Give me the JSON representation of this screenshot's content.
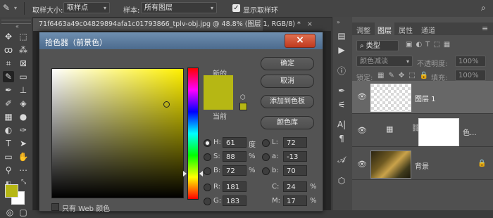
{
  "options_bar": {
    "sample_size_label": "取样大小:",
    "sample_size_value": "取样点",
    "sample_label": "样本:",
    "sample_value": "所有图层",
    "show_ring_label": "显示取样环",
    "show_ring_checked": true
  },
  "document": {
    "tab_title": "71f6463a49c04829894afa1c01793866_tplv-obj.jpg @ 48.8% (图层 1, RGB/8) *",
    "close_glyph": "×"
  },
  "color_picker": {
    "title": "拾色器（前景色）",
    "new_label": "新的",
    "current_label": "当前",
    "new_color": "#b6b714",
    "current_color": "#b6b714",
    "buttons": {
      "ok": "确定",
      "cancel": "取消",
      "add_to_swatches": "添加到色板",
      "color_libraries": "颜色库"
    },
    "hsb": {
      "h": {
        "label": "H:",
        "value": "61",
        "unit": "度",
        "selected": true
      },
      "s": {
        "label": "S:",
        "value": "88",
        "unit": "%"
      },
      "b": {
        "label": "B:",
        "value": "72",
        "unit": "%"
      }
    },
    "lab": {
      "l": {
        "label": "L:",
        "value": "72"
      },
      "a": {
        "label": "a:",
        "value": "-13"
      },
      "b": {
        "label": "b:",
        "value": "70"
      }
    },
    "rgb": {
      "r": {
        "label": "R:",
        "value": "181"
      },
      "g": {
        "label": "G:",
        "value": "183"
      }
    },
    "cmyk": {
      "c": {
        "label": "C:",
        "value": "24",
        "unit": "%"
      },
      "m": {
        "label": "M:",
        "value": "17",
        "unit": "%"
      }
    },
    "web_only_label": "只有 Web 颜色",
    "web_only_checked": false
  },
  "panels": {
    "tabs": [
      "调整",
      "图层",
      "属性",
      "通道"
    ],
    "active_tab": "图层",
    "filter_kind": "类型",
    "blend_mode": "颜色减淡",
    "opacity_label": "不透明度:",
    "opacity_value": "100%",
    "lock_label": "锁定:",
    "fill_label": "填充:",
    "fill_value": "100%",
    "layers": [
      {
        "name": "图层 1",
        "selected": true
      },
      {
        "name": "色...",
        "type": "adjustment"
      },
      {
        "name": "背景",
        "locked": true
      }
    ]
  },
  "colors": {
    "foreground": "#b6b714",
    "background": "#ffffff",
    "accent": "#b6b714"
  }
}
